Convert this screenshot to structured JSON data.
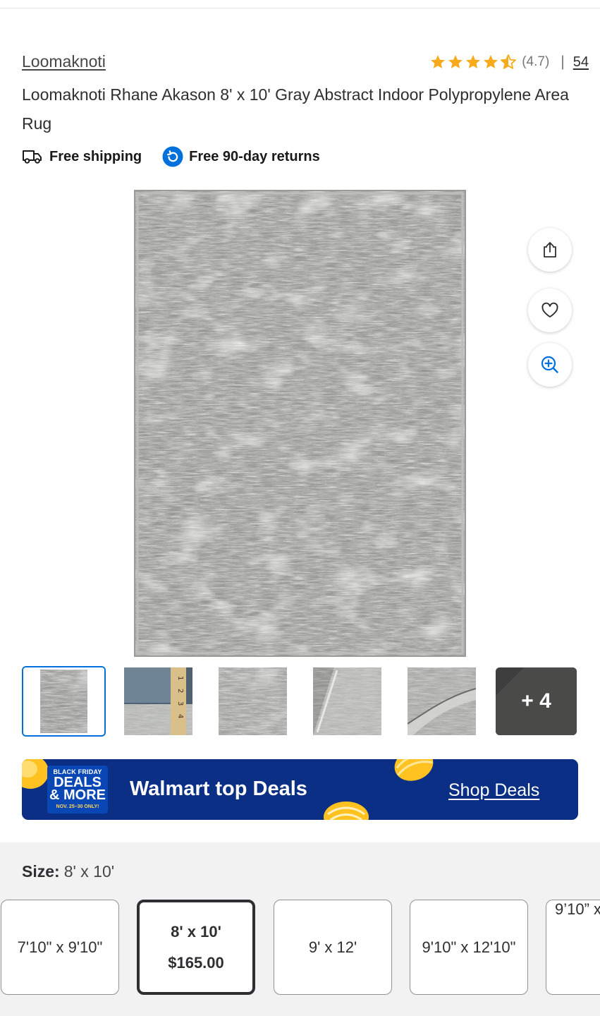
{
  "product": {
    "brand": "Loomaknoti",
    "title": "Loomaknoti Rhane Akason 8' x 10' Gray Abstract Indoor Polypropylene Area Rug",
    "rating": 4.7,
    "rating_text": "(4.7)",
    "rating_separator": "|",
    "review_count": "54",
    "perks": [
      {
        "icon": "truck-icon",
        "label": "Free shipping"
      },
      {
        "icon": "returns-icon",
        "label": "Free 90-day returns"
      }
    ]
  },
  "gallery": {
    "actions": [
      {
        "name": "share-button",
        "icon": "share-icon"
      },
      {
        "name": "favorite-button",
        "icon": "heart-icon"
      },
      {
        "name": "zoom-button",
        "icon": "zoom-in-icon"
      }
    ],
    "selected_thumbnail": 0,
    "thumbnail_count_visible": 5,
    "more_label": "+ 4"
  },
  "promo": {
    "badge_line1": "BLACK FRIDAY",
    "badge_line2": "DEALS",
    "badge_line3": "& MORE",
    "badge_line4": "NOV. 25–30 ONLY!",
    "title": "Walmart top Deals",
    "link": "Shop Deals"
  },
  "variants": {
    "size_label": "Size:",
    "selected_size": "8' x 10'",
    "options": [
      {
        "label": "7'10\" x 9'10\"",
        "price": "",
        "selected": false
      },
      {
        "label": "8' x 10'",
        "price": "$165.00",
        "selected": true
      },
      {
        "label": "9' x 12'",
        "price": "",
        "selected": false
      },
      {
        "label": "9'10\" x 12'10\"",
        "price": "",
        "selected": false
      },
      {
        "label": "9’10” x",
        "price": "",
        "selected": false
      }
    ]
  },
  "colors": {
    "accent_blue": "#0071dc",
    "star_yellow": "#f6aa1c",
    "promo_navy": "#0c2f86",
    "text_dark": "#2e2f32"
  }
}
